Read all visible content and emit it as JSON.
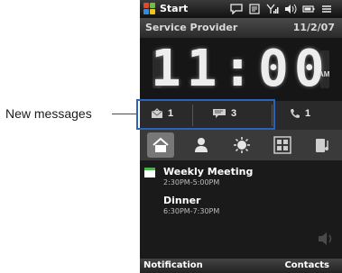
{
  "annotation": {
    "label": "New messages"
  },
  "statusbar": {
    "start_label": "Start"
  },
  "provider": {
    "name": "Service Provider",
    "date": "11/2/07"
  },
  "clock": {
    "time": "11:00",
    "ampm": "AM"
  },
  "notifications": {
    "email_count": "1",
    "sms_count": "3",
    "calls_count": "1"
  },
  "tabs": [
    {
      "icon": "home-icon"
    },
    {
      "icon": "people-icon"
    },
    {
      "icon": "weather-icon"
    },
    {
      "icon": "apps-icon"
    },
    {
      "icon": "music-icon"
    }
  ],
  "appointments": [
    {
      "title": "Weekly Meeting",
      "time": "2:30PM-5:00PM"
    },
    {
      "title": "Dinner",
      "time": "6:30PM-7:30PM"
    }
  ],
  "softkeys": {
    "left": "Notification",
    "right": "Contacts"
  },
  "colors": {
    "highlight": "#2b63b8",
    "calendar_green": "#4bb34b"
  }
}
